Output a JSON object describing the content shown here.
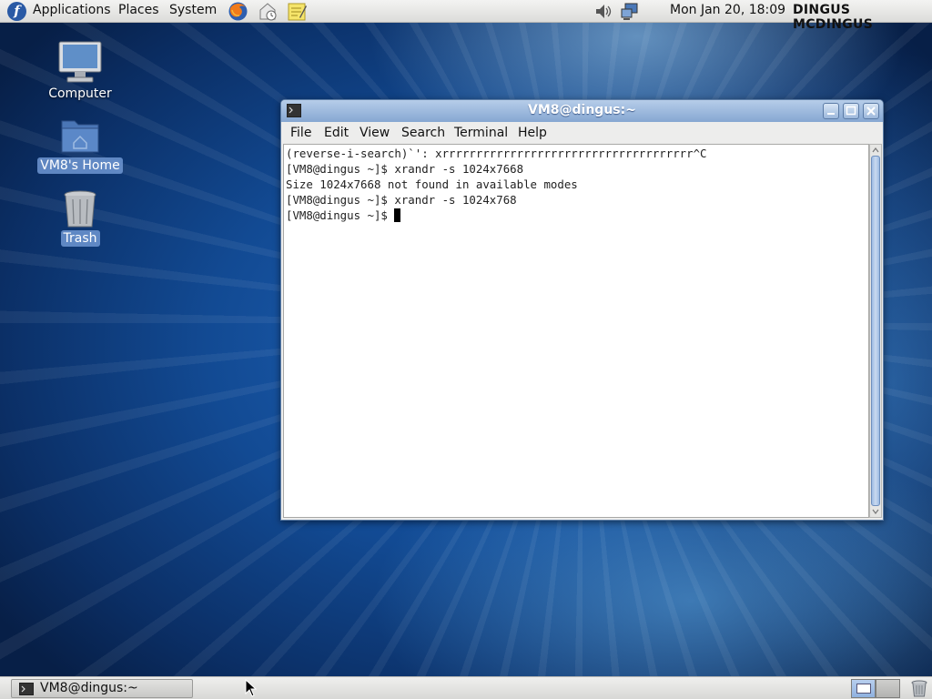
{
  "top_panel": {
    "menus": [
      "Applications",
      "Places",
      "System"
    ],
    "clock": "Mon Jan 20, 18:09",
    "user": "DINGUS MCDINGUS",
    "launchers": [
      "firefox-icon",
      "mail-icon",
      "notes-icon"
    ],
    "tray": [
      "volume-icon",
      "network-icon"
    ]
  },
  "desktop": {
    "icons": [
      {
        "label": "Computer",
        "icon": "computer-icon"
      },
      {
        "label": "VM8's Home",
        "icon": "home-folder-icon"
      },
      {
        "label": "Trash",
        "icon": "trash-icon"
      }
    ]
  },
  "window": {
    "title": "VM8@dingus:~",
    "menu": [
      "File",
      "Edit",
      "View",
      "Search",
      "Terminal",
      "Help"
    ],
    "lines": [
      "(reverse-i-search)`': xrrrrrrrrrrrrrrrrrrrrrrrrrrrrrrrrrrrrr^C",
      "[VM8@dingus ~]$ xrandr -s 1024x7668",
      "Size 1024x7668 not found in available modes",
      "[VM8@dingus ~]$ xrandr -s 1024x768",
      "[VM8@dingus ~]$ "
    ]
  },
  "taskbar": {
    "task_label": "VM8@dingus:~"
  },
  "colors": {
    "titlebar": "#86a7d2",
    "desktop": "#124a93"
  }
}
